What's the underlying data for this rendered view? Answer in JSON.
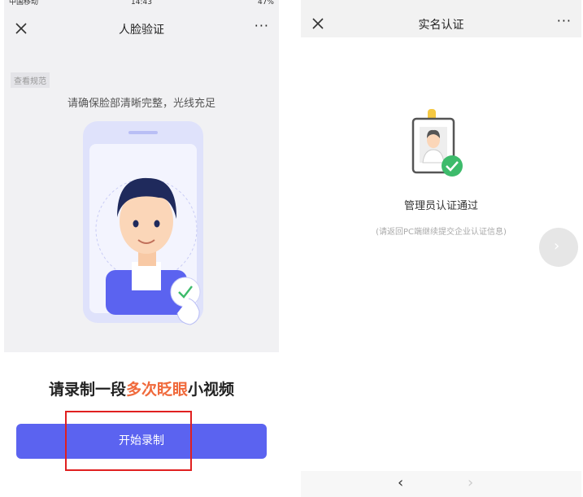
{
  "left_screen": {
    "status_bar": {
      "carrier": "中国移动",
      "time": "14:43",
      "battery": "47%"
    },
    "nav": {
      "title": "人脸验证",
      "more": "···"
    },
    "spec_link": "查看规范",
    "hint": "请确保脸部清晰完整，光线充足",
    "prompt": {
      "prefix": "请录制一段",
      "highlight": "多次眨眼",
      "suffix": "小视频"
    },
    "start_button": "开始录制",
    "colors": {
      "accent": "#5b63f0",
      "highlight": "#f06a3c",
      "annotation": "#e02020"
    }
  },
  "right_screen": {
    "nav": {
      "title": "实名认证",
      "more": "···"
    },
    "success_title": "管理员认证通过",
    "success_sub": "(请返回PC端继续提交企业认证信息)",
    "bottom_nav": {
      "back": "‹",
      "forward": "›"
    },
    "colors": {
      "success": "#3dbb6b",
      "badge_clip": "#f5c842"
    }
  }
}
